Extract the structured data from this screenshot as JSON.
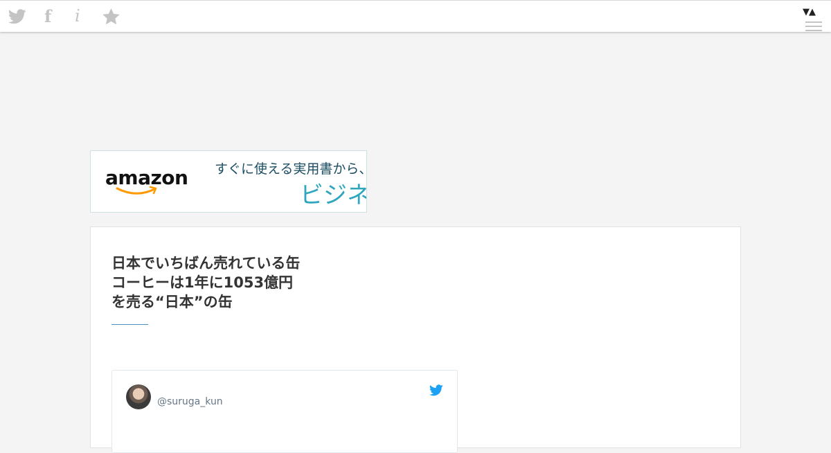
{
  "topbar": {
    "icons": [
      "twitter-icon",
      "facebook-icon",
      "info-icon",
      "star-icon"
    ],
    "facebook_glyph": "f",
    "info_glyph": "i",
    "sort_glyph": "▼▲"
  },
  "ad": {
    "brand": "amazon",
    "line1": "すぐに使える実用書から、読",
    "line2": "ビジネス"
  },
  "article": {
    "title_lines": [
      "日本でいちばん売れている缶",
      "コーヒーは1年に1053億円",
      "を売る“日本”の缶"
    ]
  },
  "tweet": {
    "handle": "@suruga_kun"
  },
  "colors": {
    "page_bg": "#f4f4f4",
    "twitter_blue": "#1da1f2",
    "ad_teal": "#2fa6bd"
  }
}
